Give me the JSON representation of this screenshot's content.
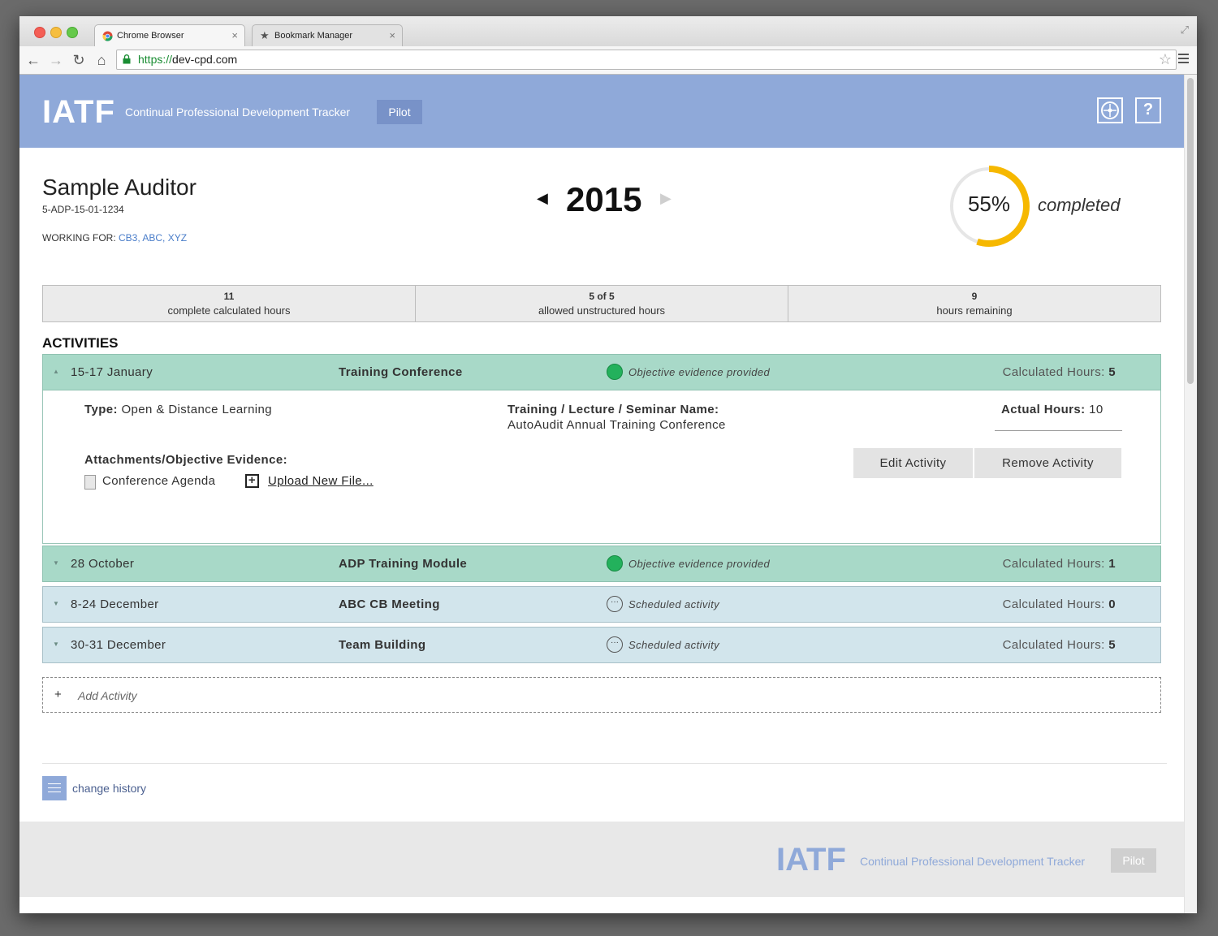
{
  "browser": {
    "tabs": [
      {
        "label": "Chrome Browser"
      },
      {
        "label": "Bookmark Manager"
      }
    ],
    "url_scheme": "https://",
    "url_host": "dev-cpd.com"
  },
  "header": {
    "logo": "IATF",
    "subtitle": "Continual Professional Development Tracker",
    "badge": "Pilot",
    "help_label": "?"
  },
  "profile": {
    "name": "Sample Auditor",
    "id": "5-ADP-15-01-1234",
    "working_for_label": "WORKING FOR: ",
    "organizations": "CB3, ABC, XYZ"
  },
  "year": {
    "value": "2015",
    "prev": "◀",
    "next": "▶"
  },
  "progress": {
    "percent": 55,
    "text": "55%",
    "label": "completed",
    "color": "#f6b800"
  },
  "stats": [
    {
      "value": "11",
      "label": "complete calculated hours"
    },
    {
      "value": "5 of 5",
      "label": "allowed unstructured hours"
    },
    {
      "value": "9",
      "label": "hours remaining"
    }
  ],
  "activities_title": "ACTIVITIES",
  "activities": [
    {
      "date": "15-17 January",
      "title": "Training Conference",
      "status": "Objective evidence provided",
      "hours_label": "Calculated Hours:",
      "hours": "5",
      "chevron": "▲"
    },
    {
      "date": "28 October",
      "title": "ADP Training Module",
      "status": "Objective evidence provided",
      "hours_label": "Calculated Hours:",
      "hours": "1",
      "chevron": "▼"
    },
    {
      "date": "8-24 December",
      "title": "ABC CB Meeting",
      "status": "Scheduled activity",
      "hours_label": "Calculated Hours:",
      "hours": "0",
      "chevron": "▼"
    },
    {
      "date": "30-31 December",
      "title": "Team Building",
      "status": "Scheduled activity",
      "hours_label": "Calculated Hours:",
      "hours": "5",
      "chevron": "▼"
    }
  ],
  "details": {
    "type_label": "Type:",
    "type_value": "Open & Distance Learning",
    "training_label": "Training / Lecture / Seminar Name:",
    "training_value": "AutoAudit Annual Training Conference",
    "actual_label": "Actual Hours:",
    "actual_value": "10",
    "attachments_label": "Attachments/Objective Evidence:",
    "file_name": "Conference Agenda",
    "upload_label": "Upload New File...",
    "edit_button": "Edit Activity",
    "remove_button": "Remove Activity"
  },
  "add_activity": {
    "plus": "+",
    "label": "Add Activity"
  },
  "history": {
    "label": "change history"
  },
  "footer": {
    "logo": "IATF",
    "subtitle": "Continual Professional Development Tracker",
    "badge": "Pilot"
  },
  "colors": {
    "header_bg": "#8fa9d9",
    "evidence_row": "#a8d9c8",
    "scheduled_row": "#d2e5ec",
    "evidence_icon": "#23b15c"
  }
}
